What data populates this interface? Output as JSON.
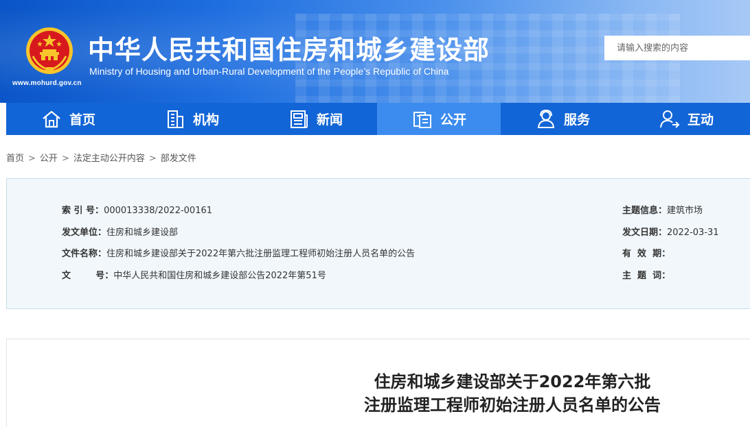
{
  "header": {
    "site_url": "www.mohurd.gov.cn",
    "title_cn": "中华人民共和国住房和城乡建设部",
    "title_en": "Ministry of Housing and Urban-Rural Development of the People’s Republic of China",
    "search_placeholder": "请输入搜索的内容",
    "colors": {
      "banner_start": "#0a55c7",
      "banner_end": "#a7c9f6",
      "emblem_red": "#d7191d",
      "emblem_gold": "#f7c52b"
    }
  },
  "nav": {
    "items": [
      {
        "label": "首页",
        "icon": "home-icon"
      },
      {
        "label": "机构",
        "icon": "building-icon"
      },
      {
        "label": "新闻",
        "icon": "news-icon"
      },
      {
        "label": "公开",
        "icon": "documents-icon",
        "active": true
      },
      {
        "label": "服务",
        "icon": "service-icon"
      },
      {
        "label": "互动",
        "icon": "interact-icon"
      }
    ],
    "colors": {
      "bg": "#1265d6",
      "active_bg": "#3c8cef"
    }
  },
  "breadcrumb": {
    "items": [
      "首页",
      "公开",
      "法定主动公开内容",
      "部发文件"
    ],
    "separator": ">"
  },
  "info": {
    "index_label": "索 引 号：",
    "index_value": "000013338/2022-00161",
    "issuer_label": "发文单位：",
    "issuer_value": "住房和城乡建设部",
    "filename_label": "文件名称：",
    "filename_value": "住房和城乡建设部关于2022年第六批注册监理工程师初始注册人员名单的公告",
    "docno_label": "文        号：",
    "docno_value": "中华人民共和国住房和城乡建设部公告2022年第51号",
    "topic_label": "主题信息：",
    "topic_value": "建筑市场",
    "date_label": "发文日期：",
    "date_value": "2022-03-31",
    "validity_label": "有  效  期：",
    "validity_value": "",
    "keywords_label": "主  题  词：",
    "keywords_value": ""
  },
  "article": {
    "title_line1": "住房和城乡建设部关于2022年第六批",
    "title_line2": "注册监理工程师初始注册人员名单的公告"
  }
}
